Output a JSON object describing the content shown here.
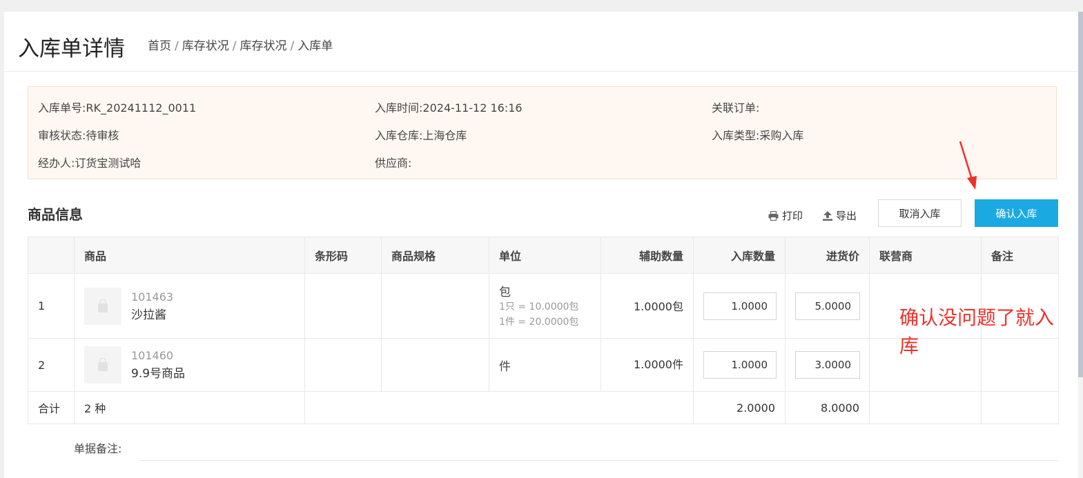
{
  "header": {
    "title": "入库单详情",
    "breadcrumb": [
      "首页",
      "库存状况",
      "库存状况",
      "入库单"
    ]
  },
  "info": {
    "order_no_label": "入库单号:",
    "order_no": "RK_20241112_0011",
    "time_label": "入库时间:",
    "time": "2024-11-12 16:16",
    "related_order_label": "关联订单:",
    "related_order": "",
    "audit_label": "审核状态:",
    "audit": "待审核",
    "warehouse_label": "入库仓库:",
    "warehouse": "上海仓库",
    "type_label": "入库类型:",
    "type": "采购入库",
    "handler_label": "经办人:",
    "handler": "订货宝测试哈",
    "supplier_label": "供应商:",
    "supplier": ""
  },
  "section": {
    "title": "商品信息",
    "print_label": "打印",
    "export_label": "导出",
    "cancel_label": "取消入库",
    "confirm_label": "确认入库"
  },
  "table": {
    "headers": {
      "idx": "",
      "product": "商品",
      "barcode": "条形码",
      "spec": "商品规格",
      "unit": "单位",
      "aux_qty": "辅助数量",
      "in_qty": "入库数量",
      "price": "进货价",
      "partner": "联营商",
      "note": "备注"
    },
    "rows": [
      {
        "idx": "1",
        "sku": "101463",
        "name": "沙拉酱",
        "barcode": "",
        "spec": "",
        "unit": "包",
        "conv1": "1只 = 10.0000包",
        "conv2": "1件 = 20.0000包",
        "aux_qty": "1.0000包",
        "in_qty": "1.0000",
        "price": "5.0000",
        "partner": "",
        "note": ""
      },
      {
        "idx": "2",
        "sku": "101460",
        "name": "9.9号商品",
        "barcode": "",
        "spec": "",
        "unit": "件",
        "aux_qty": "1.0000件",
        "in_qty": "1.0000",
        "price": "3.0000",
        "partner": "",
        "note": ""
      }
    ],
    "total": {
      "label": "合计",
      "kinds": "2 种",
      "in_qty": "2.0000",
      "price": "8.0000"
    }
  },
  "annotation": {
    "text": "确认没问题了就入库",
    "color": "#f0302a"
  },
  "remark": {
    "label": "单据备注:"
  },
  "colors": {
    "primary": "#1ba9e1",
    "panel_bg": "#fff8f2"
  }
}
